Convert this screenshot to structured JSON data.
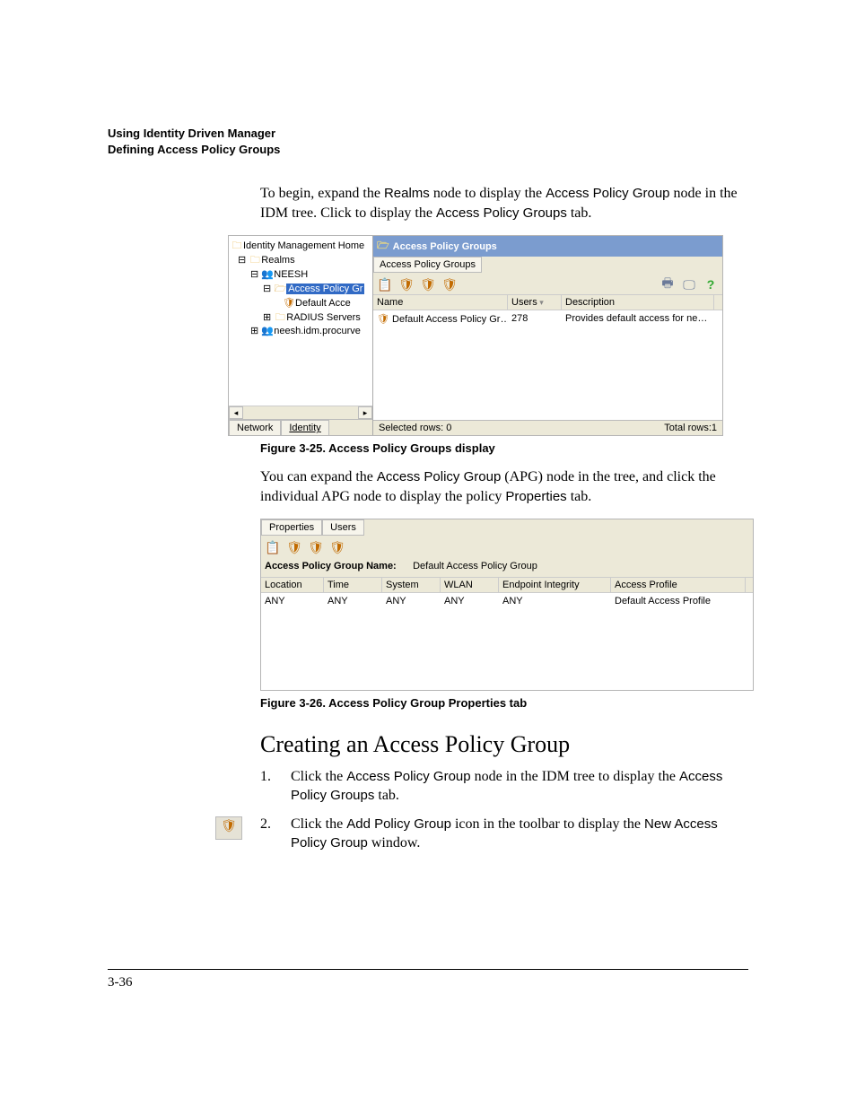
{
  "header": {
    "line1": "Using Identity Driven Manager",
    "line2": "Defining Access Policy Groups"
  },
  "intro_paragraph": {
    "pre": "To begin, expand the ",
    "s1": "Realms",
    "mid1": " node to display the ",
    "s2": "Access Policy Group",
    "mid2": " node in the IDM tree. Click to display the ",
    "s3": "Access Policy Groups",
    "post": " tab."
  },
  "figure25": {
    "tree": {
      "root": "Identity Management Home",
      "realms": "Realms",
      "realm1": "NEESH",
      "apg_node": "Access Policy Gr",
      "default_acc": "Default Acce",
      "radius": "RADIUS Servers",
      "domain": "neesh.idm.procurve"
    },
    "tree_tabs": {
      "network": "Network",
      "identity": "Identity"
    },
    "right": {
      "title": "Access Policy Groups",
      "subtab": "Access Policy Groups",
      "columns": {
        "name": "Name",
        "users": "Users",
        "description": "Description"
      },
      "row": {
        "name": "Default Access Policy Gr…",
        "users": "278",
        "description": "Provides default access for ne…"
      },
      "status_left": "Selected rows: 0",
      "status_right": "Total rows:1"
    },
    "caption": "Figure 3-25. Access Policy Groups display"
  },
  "mid_paragraph": {
    "pre": "You can expand the ",
    "s1": "Access Policy Group",
    "mid1": " (APG) node in the tree, and click the individual APG node to display the policy ",
    "s2": "Properties",
    "post": " tab."
  },
  "figure26": {
    "tabs": {
      "properties": "Properties",
      "users": "Users"
    },
    "name_label": "Access Policy Group Name:",
    "name_value": "Default Access Policy Group",
    "columns": {
      "location": "Location",
      "time": "Time",
      "system": "System",
      "wlan": "WLAN",
      "endpoint": "Endpoint Integrity",
      "profile": "Access Profile"
    },
    "row": {
      "location": "ANY",
      "time": "ANY",
      "system": "ANY",
      "wlan": "ANY",
      "endpoint": "ANY",
      "profile": "Default Access Profile"
    },
    "caption": "Figure 3-26. Access Policy Group Properties tab"
  },
  "section_heading": "Creating an Access Policy Group",
  "steps": {
    "n1": "1.",
    "t1a": "Click the ",
    "t1b": "Access Policy Group",
    "t1c": " node in the IDM tree to display the ",
    "t1d": "Access Policy Groups",
    "t1e": " tab.",
    "n2": "2.",
    "t2a": "Click the ",
    "t2b": "Add Policy Group",
    "t2c": " icon in the toolbar to display the ",
    "t2d": "New Access Policy Group",
    "t2e": " window."
  },
  "page_number": "3-36"
}
